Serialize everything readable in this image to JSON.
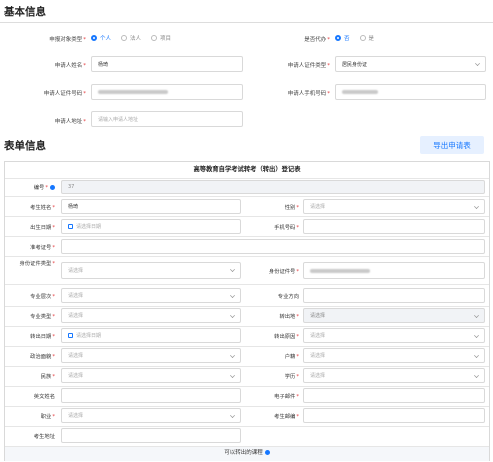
{
  "basic": {
    "title": "基本信息",
    "applicant_type_label": "申报对象类型",
    "applicant_type_options": [
      "个人",
      "法人",
      "项目"
    ],
    "agent_label": "是否代办",
    "agent_options": [
      "否",
      "是"
    ],
    "name_label": "申请人姓名",
    "name_value": "杨琦",
    "cert_type_label": "申请人证件类型",
    "cert_type_value": "居民身份证",
    "cert_no_label": "申请人证件号码",
    "phone_label": "申请人手机号码",
    "address_label": "申请人地址",
    "address_placeholder": "请输入申请人地址"
  },
  "form": {
    "title": "表单信息",
    "export_button": "导出申请表",
    "table_title": "高等教育自学考试转考（转出）登记表",
    "number_label": "编号",
    "number_value": "37",
    "exam_name_label": "考生姓名",
    "exam_name_value": "杨琦",
    "gender_label": "性别",
    "birth_label": "出生日期",
    "phone_label": "手机号码",
    "ticket_label": "准考证号",
    "id_type_label": "身份证件类型",
    "id_no_label": "身份证件号",
    "level_label": "专业层次",
    "direction_label": "专业方向",
    "major_type_label": "专业类型",
    "out_place_label": "转出地",
    "out_date_label": "转出日期",
    "out_reason_label": "转出原因",
    "politics_label": "政治面貌",
    "hukou_label": "户籍",
    "ethnic_label": "民族",
    "education_label": "学历",
    "english_name_label": "英文姓名",
    "email_label": "电子邮件",
    "job_label": "职业",
    "exam_email_label": "考生邮编",
    "exam_address_label": "考生地址",
    "courses_label": "可以转出的课程",
    "select_placeholder": "请选择",
    "date_placeholder": "请选择日期"
  }
}
